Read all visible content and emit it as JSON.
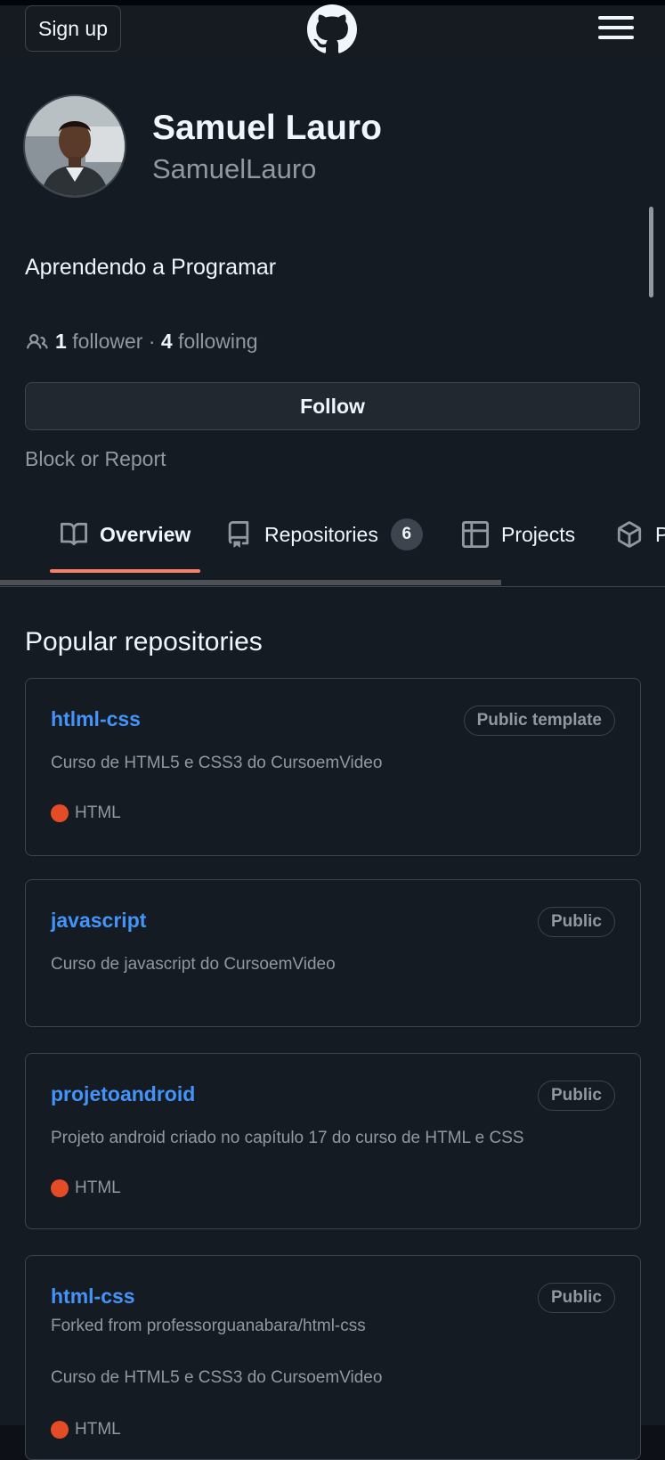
{
  "header": {
    "signup_label": "Sign up",
    "logo_icon": "github-mark-icon",
    "menu_icon": "hamburger-menu-icon"
  },
  "profile": {
    "name": "Samuel Lauro",
    "login": "SamuelLauro",
    "bio": "Aprendendo a Programar",
    "followers_count": "1",
    "followers_label": "follower",
    "separator": "·",
    "following_count": "4",
    "following_label": "following",
    "follow_label": "Follow",
    "block_label": "Block or Report"
  },
  "tabs": [
    {
      "label": "Overview",
      "icon": "book-icon",
      "selected": true
    },
    {
      "label": "Repositories",
      "icon": "repo-icon",
      "count": "6"
    },
    {
      "label": "Projects",
      "icon": "table-icon"
    },
    {
      "label": "P",
      "icon": "package-icon"
    }
  ],
  "popular": {
    "title": "Popular repositories",
    "repos": [
      {
        "name": "htlml-css",
        "visibility": "Public template",
        "description": "Curso de HTML5 e CSS3 do CursoemVideo",
        "language": "HTML",
        "language_color": "#e34c26"
      },
      {
        "name": "javascript",
        "visibility": "Public",
        "description": "Curso de javascript do CursoemVideo"
      },
      {
        "name": "projetoandroid",
        "visibility": "Public",
        "description": "Projeto android criado no capítulo 17 do curso de HTML e CSS",
        "language": "HTML",
        "language_color": "#e34c26"
      },
      {
        "name": "html-css",
        "visibility": "Public",
        "forked_from": "Forked from professorguanabara/html-css",
        "description": "Curso de HTML5 e CSS3 do CursoemVideo",
        "language": "HTML",
        "language_color": "#e34c26"
      }
    ]
  },
  "colors": {
    "background": "#151b23",
    "link": "#4493f8",
    "tab_underline": "#f78166",
    "html_language": "#e34c26"
  }
}
